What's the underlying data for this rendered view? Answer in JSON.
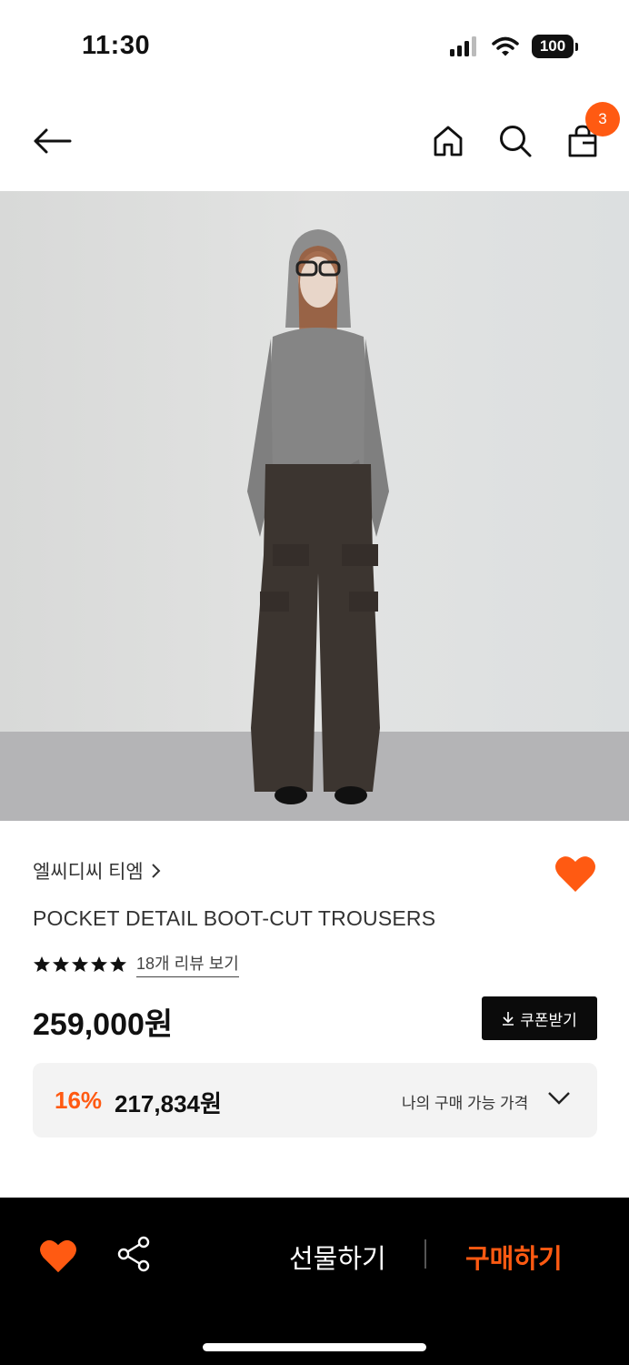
{
  "status_bar": {
    "time": "11:30",
    "battery": "100"
  },
  "header": {
    "cart_count": "3"
  },
  "product": {
    "brand": "엘씨디씨 티엠",
    "name": "POCKET DETAIL BOOT-CUT TROUSERS",
    "rating_stars": 5,
    "review_link": "18개 리뷰 보기",
    "price": "259,000원",
    "coupon_label": "쿠폰받기",
    "discount_rate": "16%",
    "discount_price": "217,834원",
    "my_price_label": "나의 구매 가능 가격"
  },
  "bottom_bar": {
    "gift_label": "선물하기",
    "buy_label": "구매하기"
  },
  "colors": {
    "accent": "#ff5a12",
    "bar": "#000000"
  }
}
